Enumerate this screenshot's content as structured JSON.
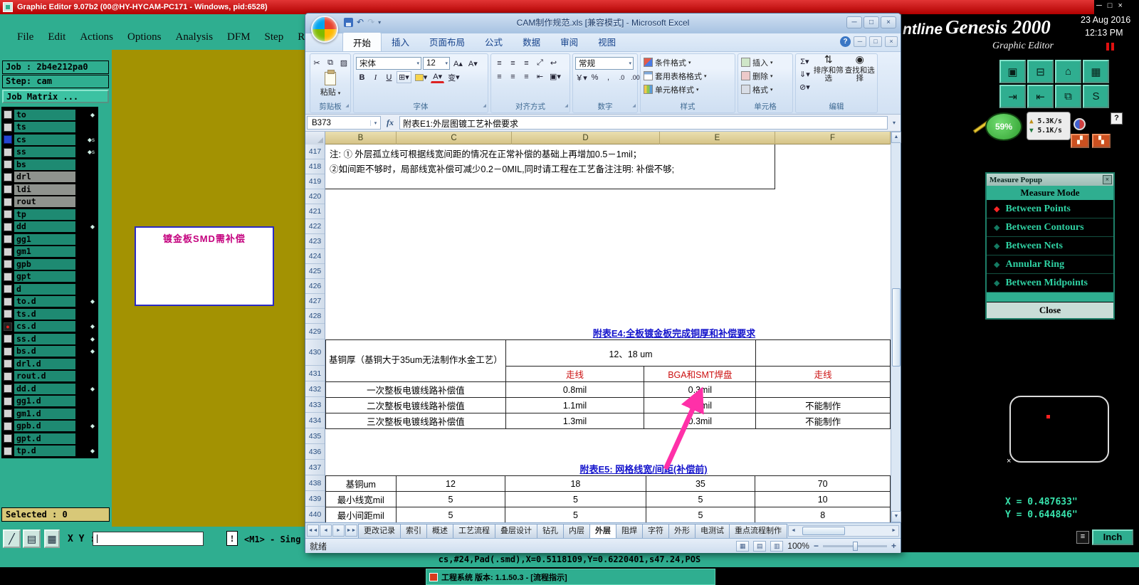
{
  "ge": {
    "title": "Graphic Editor 9.07b2 (00@HY-HYCAM-PC171 - Windows, pid:6528)",
    "window_buttons": [
      "─",
      "□",
      "×"
    ],
    "menus": [
      "File",
      "Edit",
      "Actions",
      "Options",
      "Analysis",
      "DFM",
      "Step",
      "Rout"
    ],
    "job": "Job : 2b4e212pa0",
    "step": "Step: cam",
    "job_matrix": "Job Matrix ...",
    "layers": [
      {
        "name": "to",
        "color": "teal",
        "marker": "◆",
        "sel": ""
      },
      {
        "name": "ts",
        "color": "teal",
        "marker": "",
        "sel": ""
      },
      {
        "name": "cs",
        "color": "teal",
        "marker": "◆s",
        "sel": "blue"
      },
      {
        "name": "ss",
        "color": "teal",
        "marker": "◆s",
        "sel": ""
      },
      {
        "name": "bs",
        "color": "teal",
        "marker": "",
        "sel": ""
      },
      {
        "name": "drl",
        "color": "gray",
        "marker": "",
        "sel": ""
      },
      {
        "name": "ldi",
        "color": "gray",
        "marker": "",
        "sel": ""
      },
      {
        "name": "rout",
        "color": "gray",
        "marker": "",
        "sel": ""
      },
      {
        "name": "tp",
        "color": "teal",
        "marker": "",
        "sel": ""
      },
      {
        "name": "dd",
        "color": "teal",
        "marker": "◆",
        "sel": ""
      },
      {
        "name": "gg1",
        "color": "teal",
        "marker": "",
        "sel": ""
      },
      {
        "name": "gm1",
        "color": "teal",
        "marker": "",
        "sel": ""
      },
      {
        "name": "gpb",
        "color": "teal",
        "marker": "",
        "sel": ""
      },
      {
        "name": "gpt",
        "color": "teal",
        "marker": "",
        "sel": ""
      },
      {
        "name": "d",
        "color": "teal",
        "marker": "",
        "sel": ""
      },
      {
        "name": "to.d",
        "color": "teal",
        "marker": "◆",
        "sel": ""
      },
      {
        "name": "ts.d",
        "color": "teal",
        "marker": "",
        "sel": ""
      },
      {
        "name": "cs.d",
        "color": "teal",
        "marker": "◆",
        "sel": "red"
      },
      {
        "name": "ss.d",
        "color": "teal",
        "marker": "◆",
        "sel": ""
      },
      {
        "name": "bs.d",
        "color": "teal",
        "marker": "◆",
        "sel": ""
      },
      {
        "name": "drl.d",
        "color": "teal",
        "marker": "",
        "sel": ""
      },
      {
        "name": "rout.d",
        "color": "teal",
        "marker": "",
        "sel": ""
      },
      {
        "name": "dd.d",
        "color": "teal",
        "marker": "◆",
        "sel": ""
      },
      {
        "name": "gg1.d",
        "color": "teal",
        "marker": "",
        "sel": ""
      },
      {
        "name": "gm1.d",
        "color": "teal",
        "marker": "",
        "sel": ""
      },
      {
        "name": "gpb.d",
        "color": "teal",
        "marker": "◆",
        "sel": ""
      },
      {
        "name": "gpt.d",
        "color": "teal",
        "marker": "",
        "sel": ""
      },
      {
        "name": "tp.d",
        "color": "teal",
        "marker": "◆",
        "sel": ""
      }
    ],
    "selected": "Selected : 0",
    "xy_label": "X Y :",
    "alert": "!",
    "mouse_hint": "<M1> - Sing",
    "canvas_note": "镀金板SMD需补偿",
    "status": "cs,#24,Pad(.smd),X=0.5118109,Y=0.6220401,s47.24,POS",
    "taskbar_item": "工程系统 版本: 1.1.50.3 - [流程指示]"
  },
  "excel": {
    "title": "CAM制作规范.xls [兼容模式] - Microsoft Excel",
    "window_buttons": [
      "─",
      "□",
      "×"
    ],
    "workbook_buttons": [
      "─",
      "□",
      "×"
    ],
    "help_label": "?",
    "ribbon_tabs": [
      "开始",
      "插入",
      "页面布局",
      "公式",
      "数据",
      "审阅",
      "视图"
    ],
    "active_tab": 0,
    "paste": "粘贴",
    "font_name": "宋体",
    "font_size": "12",
    "phonetic": "变",
    "number_format": "常规",
    "group_labels": [
      "剪贴板",
      "字体",
      "对齐方式",
      "数字",
      "样式",
      "单元格",
      "编辑"
    ],
    "style_buttons": [
      "条件格式",
      "套用表格格式",
      "单元格样式"
    ],
    "cell_buttons": [
      "插入",
      "删除",
      "格式"
    ],
    "sort_button": "排序和筛选",
    "find_button": "查找和选择",
    "name_box": "B373",
    "fx": "fx",
    "formula": "附表E1:外层图镀工艺补偿要求",
    "columns": [
      "B",
      "C",
      "D",
      "E",
      "F"
    ],
    "row_numbers": [
      "417",
      "418",
      "419",
      "420",
      "421",
      "422",
      "423",
      "424",
      "425",
      "426",
      "427",
      "428",
      "429",
      "430",
      "431",
      "432",
      "433",
      "434",
      "435",
      "436",
      "437",
      "438",
      "439",
      "440"
    ],
    "note1": "注: ① 外层孤立线可根据线宽间距的情况在正常补偿的基础上再增加0.5－1mil；",
    "note2": "②如间距不够时，局部线宽补偿可减少0.2－0MIL,同时请工程在工艺备注注明: 补偿不够;",
    "e4_title": "附表E4:全板镀金板完成铜厚和补偿要求",
    "e4": {
      "corner": "基铜厚（基铜大于35um无法制作水金工艺）",
      "span_header": "12、18 um",
      "cols": [
        "走线",
        "BGA和SMT焊盘",
        "走线"
      ],
      "rows": [
        {
          "label": "一次整板电镀线路补偿值",
          "trace": "0.8mil",
          "pad": "0.3mil",
          "f": ""
        },
        {
          "label": "二次整板电镀线路补偿值",
          "trace": "1.1mil",
          "pad": "0.3mil",
          "f": "不能制作"
        },
        {
          "label": "三次整板电镀线路补偿值",
          "trace": "1.3mil",
          "pad": "0.3mil",
          "f": "不能制作"
        }
      ]
    },
    "e5_title": "附表E5: 网格线宽/间距(补偿前)",
    "e5": {
      "rows": [
        {
          "label": "基铜um",
          "values": [
            "12",
            "18",
            "35",
            "70"
          ]
        },
        {
          "label": "最小线宽mil",
          "values": [
            "5",
            "5",
            "5",
            "10"
          ]
        },
        {
          "label": "最小间距mil",
          "values": [
            "5",
            "5",
            "5",
            "8"
          ]
        }
      ]
    },
    "sheet_tabs": [
      "更改记录",
      "索引",
      "概述",
      "工艺流程",
      "叠层设计",
      "钻孔",
      "内层",
      "外层",
      "阻焊",
      "字符",
      "外形",
      "电测试",
      "重点流程制作"
    ],
    "active_sheet": 7,
    "status_ready": "就绪",
    "zoom": "100%"
  },
  "genesis": {
    "frontline": "ntline",
    "brand": "Genesis 2000",
    "brand_sub": "Graphic Editor",
    "date": "23 Aug 2016",
    "time": "12:13 PM",
    "gauge": "59%",
    "net_up": "5.3K/s",
    "net_down": "5.1K/s",
    "toolbar_icons": [
      {
        "name": "snapshot-icon",
        "glyph": "▣"
      },
      {
        "name": "monitor-icon",
        "glyph": "⊟"
      },
      {
        "name": "home-icon",
        "glyph": "⌂"
      },
      {
        "name": "grid-icon",
        "glyph": "▦"
      },
      {
        "name": "zoom-in-icon",
        "glyph": "⇥"
      },
      {
        "name": "zoom-out-icon",
        "glyph": "⇤"
      },
      {
        "name": "windows-icon",
        "glyph": "⧉"
      },
      {
        "name": "profile-icon",
        "glyph": "S"
      }
    ],
    "measure": {
      "title": "Measure Popup",
      "header": "Measure Mode",
      "options": [
        "Between Points",
        "Between Contours",
        "Between Nets",
        "Annular Ring",
        "Between Midpoints"
      ],
      "selected": 0,
      "close": "Close"
    },
    "coord_x": "X = 0.487633\"",
    "coord_y": "Y = 0.644846\"",
    "units": "Inch"
  }
}
